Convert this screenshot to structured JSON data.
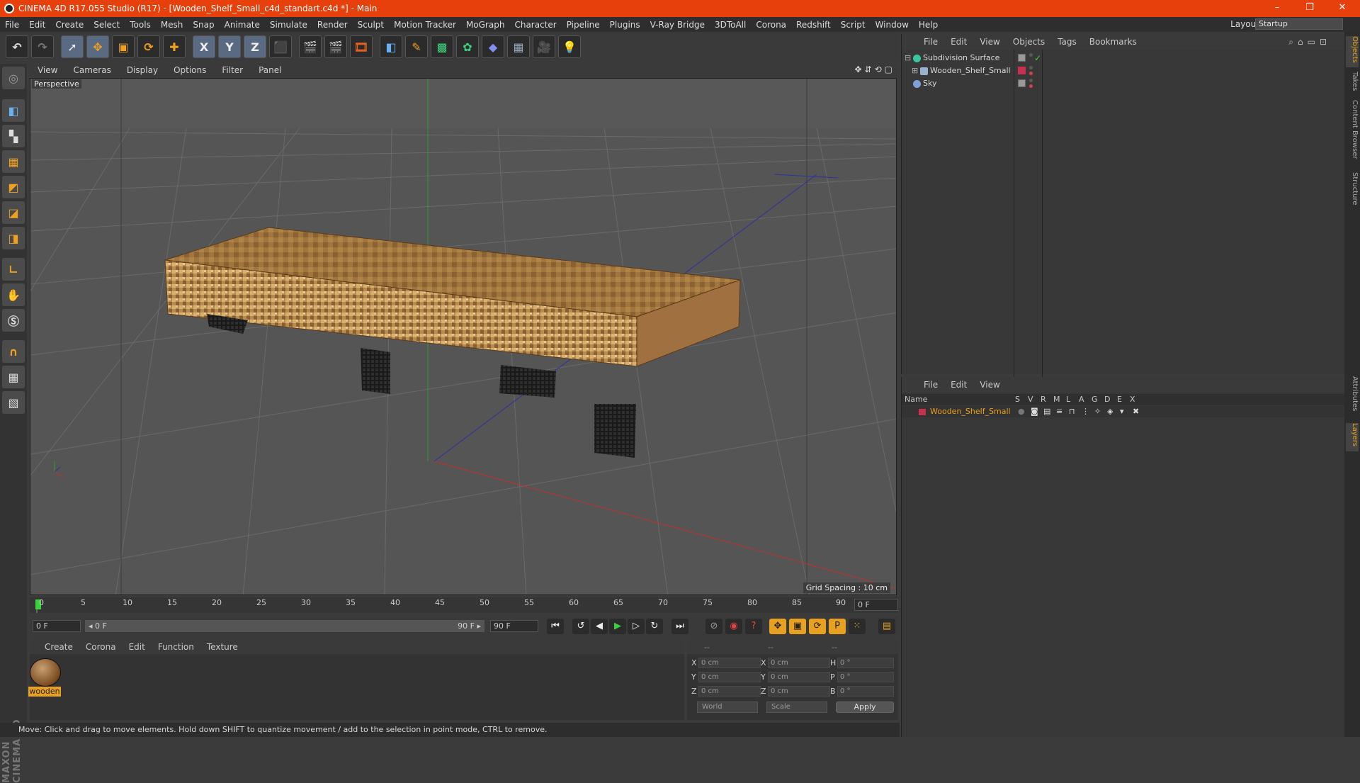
{
  "window": {
    "title": "CINEMA 4D R17.055 Studio (R17) - [Wooden_Shelf_Small_c4d_standart.c4d *] - Main",
    "min": "–",
    "restore": "❐",
    "close": "✕"
  },
  "menubar": {
    "items": [
      "File",
      "Edit",
      "Create",
      "Select",
      "Tools",
      "Mesh",
      "Snap",
      "Animate",
      "Simulate",
      "Render",
      "Sculpt",
      "Motion Tracker",
      "MoGraph",
      "Character",
      "Pipeline",
      "Plugins",
      "V-Ray Bridge",
      "3DToAll",
      "Corona",
      "Redshift",
      "Script",
      "Window",
      "Help"
    ],
    "layout_label": "Layout:",
    "layout_value": "Startup"
  },
  "toolbar": {
    "axis_x": "X",
    "axis_y": "Y",
    "axis_z": "Z"
  },
  "viewport": {
    "menu": [
      "View",
      "Cameras",
      "Display",
      "Options",
      "Filter",
      "Panel"
    ],
    "label": "Perspective",
    "grid_spacing": "Grid Spacing : 10 cm",
    "nav_icons": "✥⇵⟲▢"
  },
  "timeline": {
    "ticks": [
      "0",
      "5",
      "10",
      "15",
      "20",
      "25",
      "30",
      "35",
      "40",
      "45",
      "50",
      "55",
      "60",
      "65",
      "70",
      "75",
      "80",
      "85",
      "90"
    ],
    "current_frame": "0 F"
  },
  "transport": {
    "start_field": "0 F",
    "range_start": "◂ 0 F",
    "range_end": "90 F ▸",
    "end_field": "90 F"
  },
  "material_manager": {
    "menu": [
      "Create",
      "Corona",
      "Edit",
      "Function",
      "Texture"
    ],
    "material_name": "wooden"
  },
  "coordinates": {
    "headers": [
      "--",
      "--",
      "--"
    ],
    "rows": [
      {
        "a": "X",
        "av": "0 cm",
        "b": "X",
        "bv": "0 cm",
        "c": "H",
        "cv": "0 °"
      },
      {
        "a": "Y",
        "av": "0 cm",
        "b": "Y",
        "bv": "0 cm",
        "c": "P",
        "cv": "0 °"
      },
      {
        "a": "Z",
        "av": "0 cm",
        "b": "Z",
        "bv": "0 cm",
        "c": "B",
        "cv": "0 °"
      }
    ],
    "mode": "World",
    "scale": "Scale",
    "apply": "Apply"
  },
  "object_manager": {
    "menu": [
      "File",
      "Edit",
      "View",
      "Objects",
      "Tags",
      "Bookmarks"
    ],
    "objects": [
      {
        "name": "Subdivision Surface",
        "icon_color": "#38c8a0"
      },
      {
        "name": "Wooden_Shelf_Small",
        "icon_color": "#9ab0d0"
      },
      {
        "name": "Sky",
        "icon_color": "#7fa0d8"
      }
    ]
  },
  "layer_manager": {
    "menu": [
      "File",
      "Edit",
      "View"
    ],
    "columns": [
      "Name",
      "S",
      "V",
      "R",
      "M",
      "L",
      "A",
      "G",
      "D",
      "E",
      "X"
    ],
    "layers": [
      {
        "name": "Wooden_Shelf_Small",
        "color": "#c83050"
      }
    ]
  },
  "status": {
    "text": "Move: Click and drag to move elements. Hold down SHIFT to quantize movement / add to the selection in point mode, CTRL to remove."
  },
  "right_tabs": [
    "Objects",
    "Takes",
    "Content Browser",
    "Structure",
    "Attributes",
    "Layers"
  ],
  "colors": {
    "title_bar": "#e8400c",
    "accent": "#e8a020"
  }
}
